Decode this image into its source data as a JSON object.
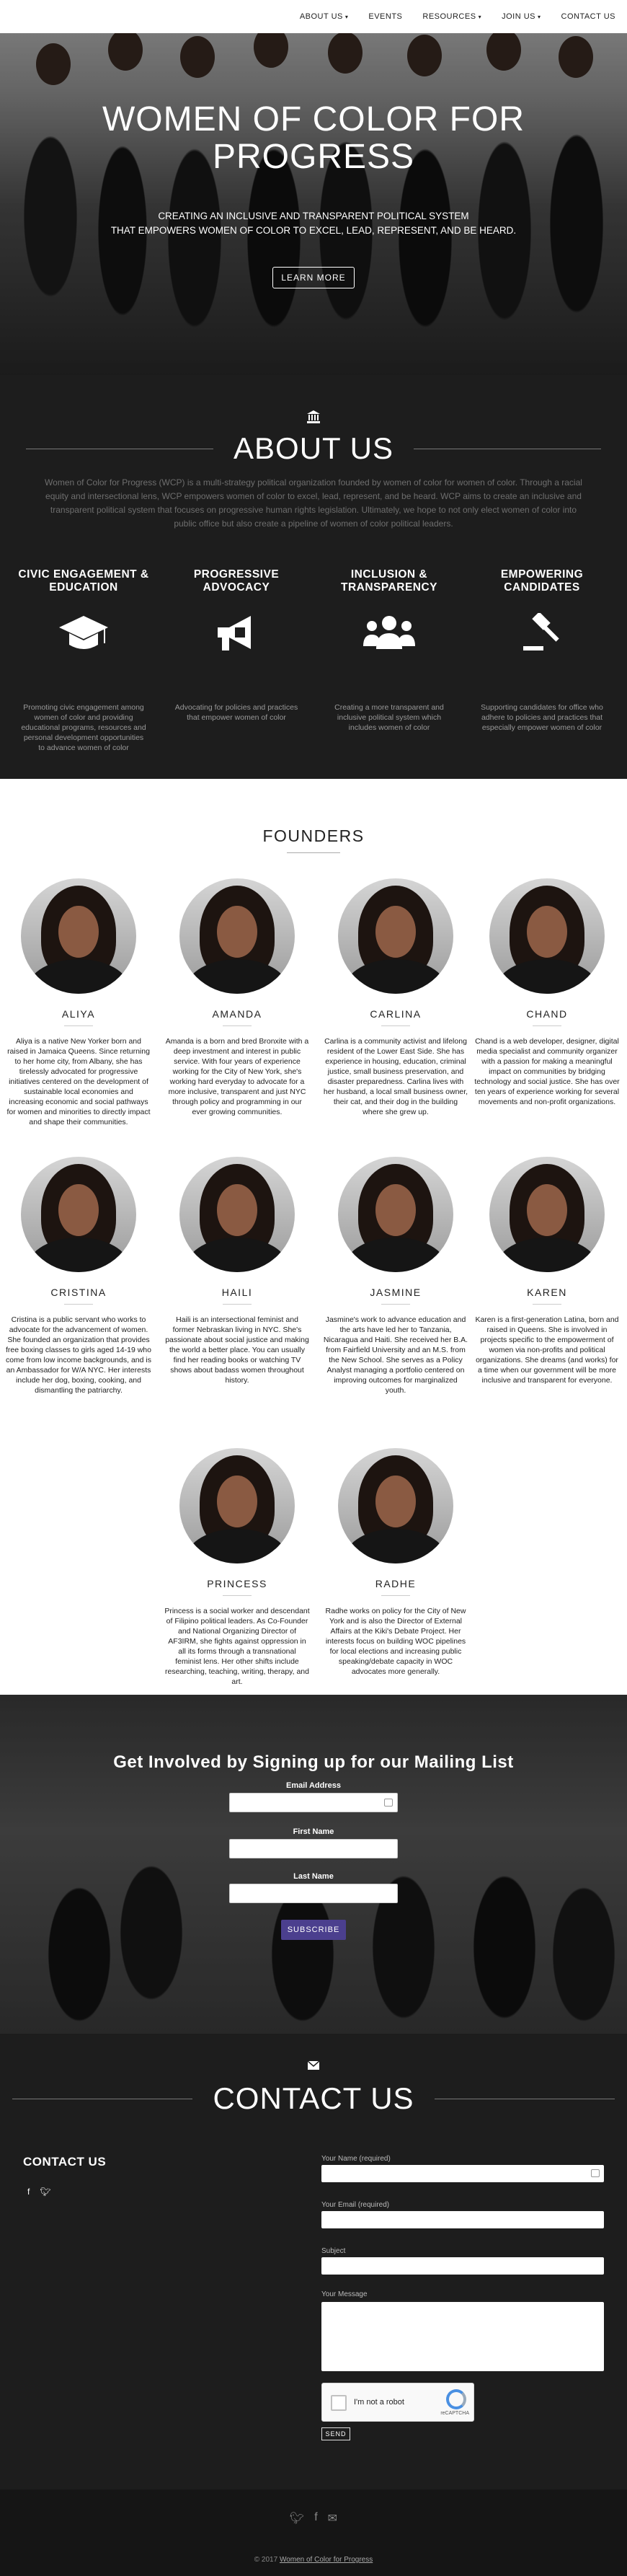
{
  "nav": {
    "items": [
      {
        "label": "ABOUT US",
        "dropdown": true
      },
      {
        "label": "EVENTS",
        "dropdown": false
      },
      {
        "label": "RESOURCES",
        "dropdown": true
      },
      {
        "label": "JOIN US",
        "dropdown": true
      },
      {
        "label": "CONTACT US",
        "dropdown": false
      }
    ]
  },
  "hero": {
    "title": "WOMEN OF COLOR FOR PROGRESS",
    "subtitle_line1": "CREATING AN INCLUSIVE AND TRANSPARENT POLITICAL SYSTEM",
    "subtitle_line2": "THAT EMPOWERS WOMEN OF COLOR TO EXCEL, LEAD, REPRESENT, AND BE HEARD.",
    "button": "LEARN MORE"
  },
  "about": {
    "title": "ABOUT US",
    "intro": "Women of Color for Progress (WCP) is a multi-strategy political organization founded by women of color for women of color. Through a racial equity and intersectional lens, WCP empowers women of color to excel, lead, represent, and be heard. WCP aims to create an inclusive and transparent political system that focuses on progressive human rights legislation. Ultimately, we hope to not only elect women of color into public office but also create a pipeline of women of color political leaders.",
    "columns": [
      {
        "title": "CIVIC ENGAGEMENT & EDUCATION",
        "icon": "graduation-cap-icon",
        "text": "Promoting civic engagement among women of color and providing educational programs, resources and personal development opportunities to advance women of color"
      },
      {
        "title": "PROGRESSIVE ADVOCACY",
        "icon": "bullhorn-icon",
        "text": "Advocating for policies and practices that empower women of color"
      },
      {
        "title": "INCLUSION & TRANSPARENCY",
        "icon": "users-icon",
        "text": "Creating a more transparent and inclusive political system which includes women of color"
      },
      {
        "title": "EMPOWERING CANDIDATES",
        "icon": "gavel-icon",
        "text": "Supporting candidates for office who adhere to policies and practices that especially empower women of color"
      }
    ]
  },
  "founders": {
    "title": "FOUNDERS",
    "people": [
      {
        "name": "ALIYA",
        "bio": "Aliya is a native New Yorker born and raised in Jamaica Queens. Since returning to her home city, from Albany, she has tirelessly advocated for progressive initiatives centered on the development of sustainable local economies and increasing economic and social pathways for women and minorities to directly impact and shape their communities."
      },
      {
        "name": "AMANDA",
        "bio": "Amanda is a born and bred Bronxite with a deep investment and interest in public service. With four years of experience working for the City of New York, she's working hard everyday to advocate for a more inclusive, transparent and just NYC through policy and programming in our ever growing communities."
      },
      {
        "name": "CARLINA",
        "bio": "Carlina is a community activist and lifelong resident of the Lower East Side. She has experience in housing, education, criminal justice, small business preservation, and disaster preparedness. Carlina lives with her husband, a local small business owner, their cat, and their dog in the building where she grew up."
      },
      {
        "name": "CHAND",
        "bio": "Chand is a web developer, designer, digital media specialist and community organizer with a passion for making a meaningful impact on communities by bridging technology and social justice. She has over ten years of experience working for several movements and non-profit organizations."
      },
      {
        "name": "CRISTINA",
        "bio": "Cristina is a public servant who works to advocate for the advancement of women. She founded an organization that provides free boxing classes to girls aged 14-19 who come from low income backgrounds, and is an Ambassador for W/A NYC. Her interests include her dog, boxing, cooking, and dismantling the patriarchy."
      },
      {
        "name": "HAILI",
        "bio": "Haili is an intersectional feminist and former Nebraskan living in NYC. She's passionate about social justice and making the world a better place. You can usually find her reading books or watching TV shows about badass women throughout history."
      },
      {
        "name": "JASMINE",
        "bio": "Jasmine's work to advance education and the arts have led her to Tanzania, Nicaragua and Haiti. She received her B.A. from Fairfield University and an M.S. from the New School. She serves as a Policy Analyst managing a portfolio centered on improving outcomes for marginalized youth."
      },
      {
        "name": "KAREN",
        "bio": "Karen is a first-generation Latina, born and raised in Queens. She is involved in projects specific to the empowerment of women via non-profits and political organizations. She dreams (and works) for a time when our government will be more inclusive and transparent for everyone."
      },
      {
        "name": "PRINCESS",
        "bio": "Princess is a social worker and descendant of Filipino political leaders. As Co-Founder and National Organizing Director of AF3IRM, she fights against oppression in all its forms through a transnational feminist lens. Her other shifts include researching, teaching, writing, therapy, and art."
      },
      {
        "name": "RADHE",
        "bio": "Radhe works on policy for the City of New York and is also the Director of External Affairs at the Kiki's Debate Project. Her interests focus on building WOC pipelines for local elections and increasing public speaking/debate capacity in WOC advocates more generally."
      }
    ]
  },
  "mailing": {
    "title": "Get Involved by Signing up for our Mailing List",
    "email_label": "Email Address",
    "first_label": "First Name",
    "last_label": "Last Name",
    "button": "SUBSCRIBE"
  },
  "contact": {
    "title": "CONTACT US",
    "side_title": "CONTACT US",
    "social": [
      "facebook-icon",
      "twitter-icon"
    ],
    "name_label": "Your Name (required)",
    "email_label": "Your Email (required)",
    "subject_label": "Subject",
    "message_label": "Your Message",
    "captcha_label": "I'm not a robot",
    "captcha_brand": "reCAPTCHA",
    "send": "SEND"
  },
  "footer": {
    "social": [
      "twitter-icon",
      "facebook-icon",
      "envelope-icon"
    ],
    "copy_prefix": "© 2017",
    "copy_link": "Women of Color for Progress"
  }
}
